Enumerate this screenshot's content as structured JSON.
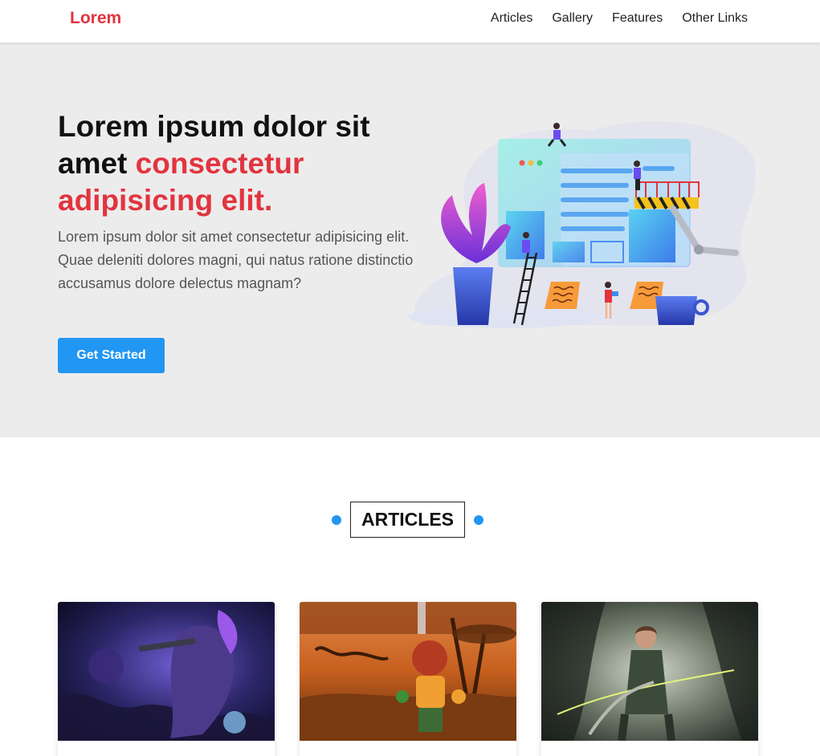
{
  "header": {
    "logo": "Lorem",
    "nav": [
      "Articles",
      "Gallery",
      "Features",
      "Other Links"
    ]
  },
  "hero": {
    "title_plain": "Lorem ipsum dolor sit amet ",
    "title_accent": "consectetur adipisicing elit.",
    "text": "Lorem ipsum dolor sit amet consectetur adipisicing elit. Quae deleniti dolores magni, qui natus ratione distinctio accusamus dolore delectus magnam?",
    "cta_label": "Get Started"
  },
  "articles": {
    "heading": "ARTICLES"
  },
  "colors": {
    "accent_red": "#e2343f",
    "accent_blue": "#2196f3",
    "hero_bg": "#ececec"
  },
  "icons": [
    "hero-illustration"
  ]
}
